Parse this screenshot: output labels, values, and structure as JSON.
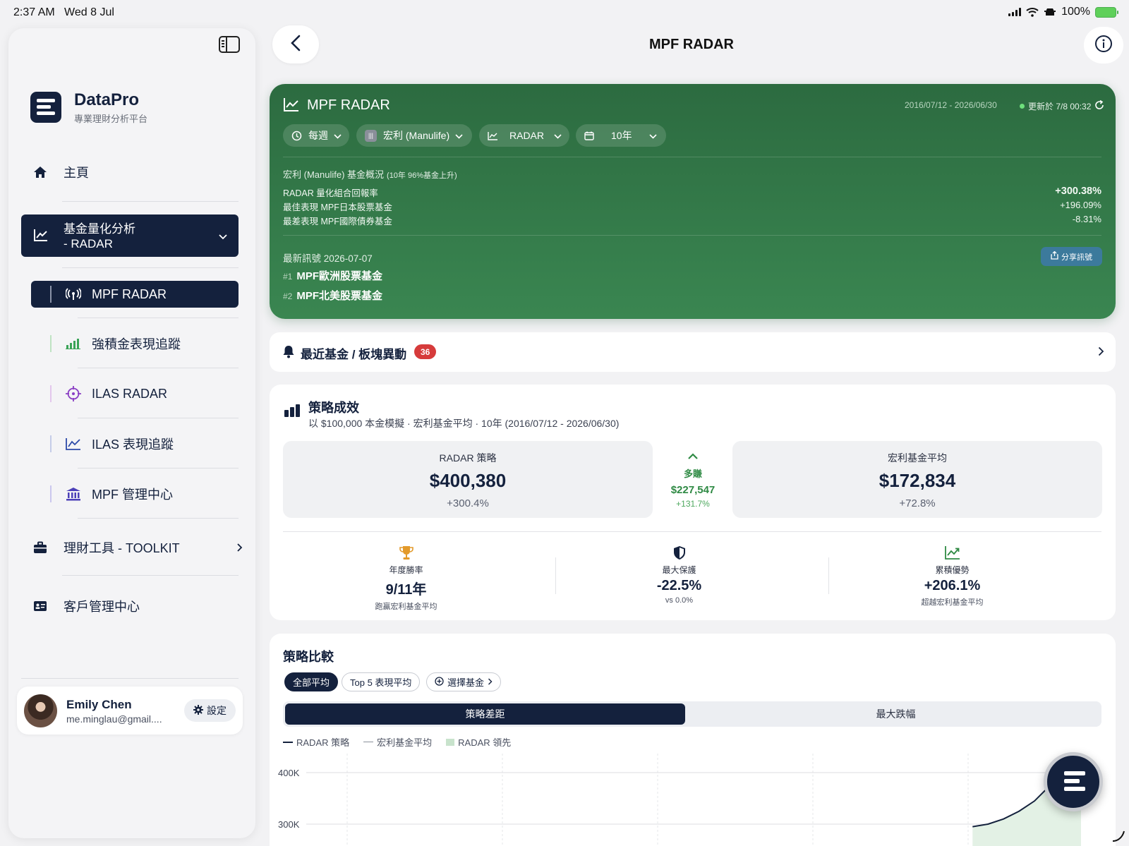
{
  "status": {
    "time": "2:37 AM",
    "date": "Wed 8 Jul",
    "battery": "100%"
  },
  "brand": {
    "name": "DataPro",
    "subtitle": "專業理財分析平台"
  },
  "nav": {
    "home": "主頁",
    "radar_group": "基金量化分析",
    "radar_group_2": "- RADAR",
    "sub_items": [
      "MPF RADAR",
      "強積金表現追蹤",
      "ILAS RADAR",
      "ILAS 表現追蹤",
      "MPF 管理中心"
    ],
    "toolkit": "理財工具 - TOOLKIT",
    "clients": "客戶管理中心"
  },
  "user": {
    "name": "Emily Chen",
    "email": "me.minglau@gmail....",
    "settings_label": "設定"
  },
  "header": {
    "title": "MPF RADAR"
  },
  "green": {
    "title": "MPF RADAR",
    "range": "2016/07/12 - 2026/06/30",
    "updated": "更新於 7/8 00:32",
    "filters": [
      "每週",
      "宏利 (Manulife)",
      "RADAR",
      "10年"
    ],
    "overview_title": "宏利 (Manulife) 基金概況",
    "overview_note": "(10年 96%基金上升)",
    "rows": [
      {
        "label": "RADAR 量化組合回報率",
        "value": "+300.38%"
      },
      {
        "label": "最佳表現 MPF日本股票基金",
        "value": "+196.09%"
      },
      {
        "label": "最差表現 MPF國際債券基金",
        "value": "-8.31%"
      }
    ],
    "signal_title": "最新訊號 2026-07-07",
    "share_label": "分享訊號",
    "signals": [
      {
        "rank": "#1",
        "name": "MPF歐洲股票基金"
      },
      {
        "rank": "#2",
        "name": "MPF北美股票基金"
      }
    ]
  },
  "alert": {
    "label": "最近基金 / 板塊異動",
    "count": "36"
  },
  "strategy": {
    "title": "策略成效",
    "subtitle": "以 $100,000 本金模擬 · 宏利基金平均 · 10年 (2016/07/12 - 2026/06/30)",
    "left": {
      "title": "RADAR 策略",
      "value": "$400,380",
      "pct": "+300.4%"
    },
    "mid": {
      "title": "多賺",
      "value": "$227,547",
      "pct": "+131.7%"
    },
    "right": {
      "title": "宏利基金平均",
      "value": "$172,834",
      "pct": "+72.8%"
    },
    "stats": [
      {
        "title": "年度勝率",
        "value": "9/11年",
        "sub": "跑贏宏利基金平均"
      },
      {
        "title": "最大保護",
        "value": "-22.5%",
        "sub": "vs 0.0%"
      },
      {
        "title": "累積優勢",
        "value": "+206.1%",
        "sub": "超越宏利基金平均"
      }
    ]
  },
  "compare": {
    "title": "策略比較",
    "chips": [
      "全部平均",
      "Top 5 表現平均",
      "選擇基金"
    ],
    "segments": [
      "策略差距",
      "最大跌幅"
    ],
    "legend": [
      "RADAR 策略",
      "宏利基金平均",
      "RADAR 領先"
    ]
  },
  "chart_data": {
    "type": "line",
    "title": "",
    "xlabel": "",
    "ylabel": "",
    "y_ticks": [
      "400K",
      "300K"
    ],
    "ylim": [
      300000,
      400000
    ],
    "series": [
      {
        "name": "RADAR 策略",
        "x": [
          0.86,
          0.88,
          0.9,
          0.92,
          0.94,
          0.96,
          0.98,
          1.0
        ],
        "values": [
          295000,
          300000,
          310000,
          325000,
          345000,
          375000,
          400000,
          398000
        ]
      },
      {
        "name": "宏利基金平均",
        "x": [],
        "values": []
      }
    ],
    "grid": true,
    "legend": "top-left"
  }
}
